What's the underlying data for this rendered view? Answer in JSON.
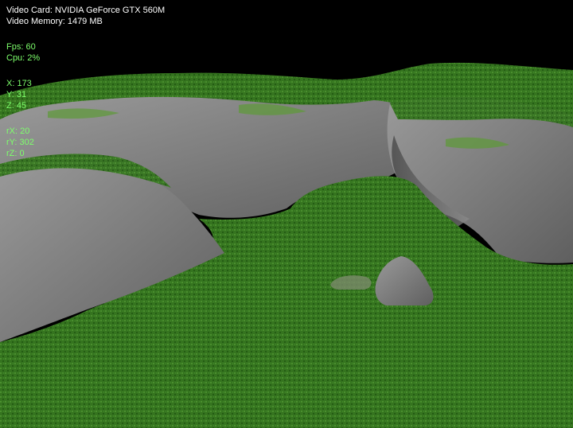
{
  "hud": {
    "video_card": "Video Card: NVIDIA GeForce GTX 560M",
    "video_memory": "Video Memory: 1479 MB",
    "fps": "Fps: 60",
    "cpu": "Cpu: 2%",
    "pos_x": "X: 173",
    "pos_y": "Y: 31",
    "pos_z": "Z: 45",
    "rot_x": "rX: 20",
    "rot_y": "rY: 302",
    "rot_z": "rZ: 0"
  },
  "colors": {
    "sky": "#000000",
    "grass": "#2f6f1f",
    "rock": "#8a8a8a",
    "hud_white": "#ffffff",
    "hud_green": "#7dff6b"
  }
}
